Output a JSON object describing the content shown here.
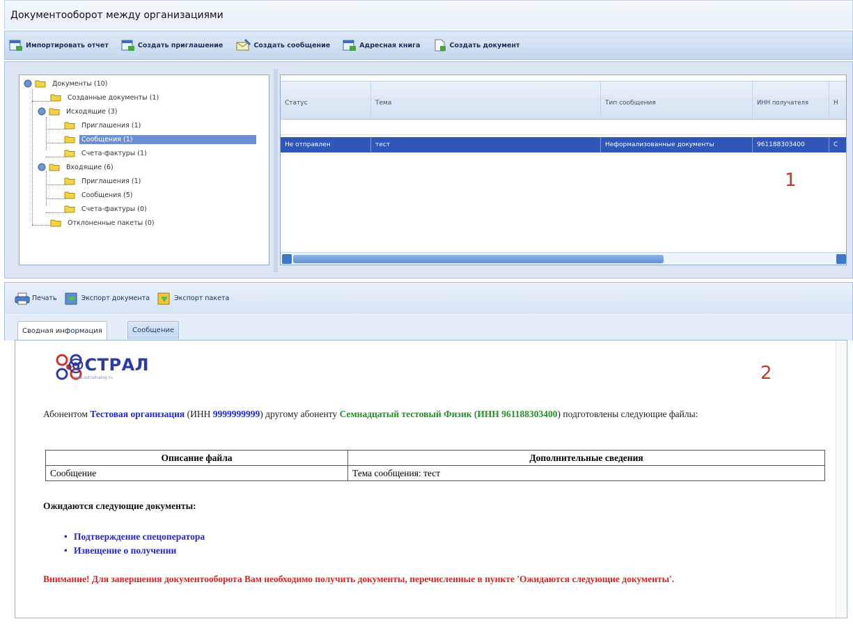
{
  "window": {
    "title": "Документооборот между организациями"
  },
  "toolbar": {
    "import_label": "Импортировать отчет",
    "invite_label": "Создать приглашение",
    "message_label": "Создать сообщение",
    "addressbook_label": "Адресная книга",
    "document_label": "Создать документ"
  },
  "tree": {
    "root": "Документы (10)",
    "created": "Созданные документы (1)",
    "outgoing": "Исходящие (3)",
    "out_invites": "Приглашения (1)",
    "out_messages": "Сообщения (1)",
    "out_invoices": "Счета-фактуры (1)",
    "incoming": "Входящие (6)",
    "in_invites": "Приглашения (1)",
    "in_messages": "Сообщения (5)",
    "in_invoices": "Счета-фактуры (0)",
    "rejected": "Отклоненные пакеты (0)",
    "selected": "out_messages"
  },
  "grid": {
    "columns": [
      "Статус",
      "Тема",
      "Тип сообщения",
      "ИНН получателя",
      "Н"
    ],
    "rows": [
      [
        "Не отправлен",
        "тест",
        "Неформализованные документы",
        "961188303400",
        "С"
      ]
    ]
  },
  "markers": {
    "one": "1",
    "two": "2"
  },
  "bottom_toolbar": {
    "print_label": "Печать",
    "export_doc_label": "Экспорт документа",
    "export_pkg_label": "Экспорт пакета"
  },
  "tabs": {
    "summary": "Сводная информация",
    "message": "Сообщение",
    "active": "summary"
  },
  "content": {
    "logo_text": "@СТРАЛ",
    "logo_sub": "www.astralnalog.ru",
    "intro_1": "Абонентом ",
    "sender": "Тестовая организация",
    "intro_2": " (ИНН ",
    "sender_inn": "9999999999",
    "intro_3": ") другому абоненту ",
    "recipient": "Семнадцатый тестовый Физик (ИНН 961188303400",
    "intro_4": ") подготовлены следующие файлы:",
    "table_headers": [
      "Описание файла",
      "Дополнительные сведения"
    ],
    "table_rows": [
      [
        "Сообщение",
        "Тема сообщения: тест"
      ]
    ],
    "expect_title": "Ожидаются следующие документы:",
    "expect_items": [
      "Подтверждение спецоператора",
      "Извещение о получении"
    ],
    "warning": "Внимание! Для завершения документооборота Вам необходимо получить документы, перечисленные в пункте 'Ожидаются следующие документы'."
  },
  "colors": {
    "selection": "#2f56b8",
    "link_blue": "#2727c8",
    "green": "#2b8a2b",
    "warning_red": "#e02020",
    "marker_red": "#c0392b"
  }
}
